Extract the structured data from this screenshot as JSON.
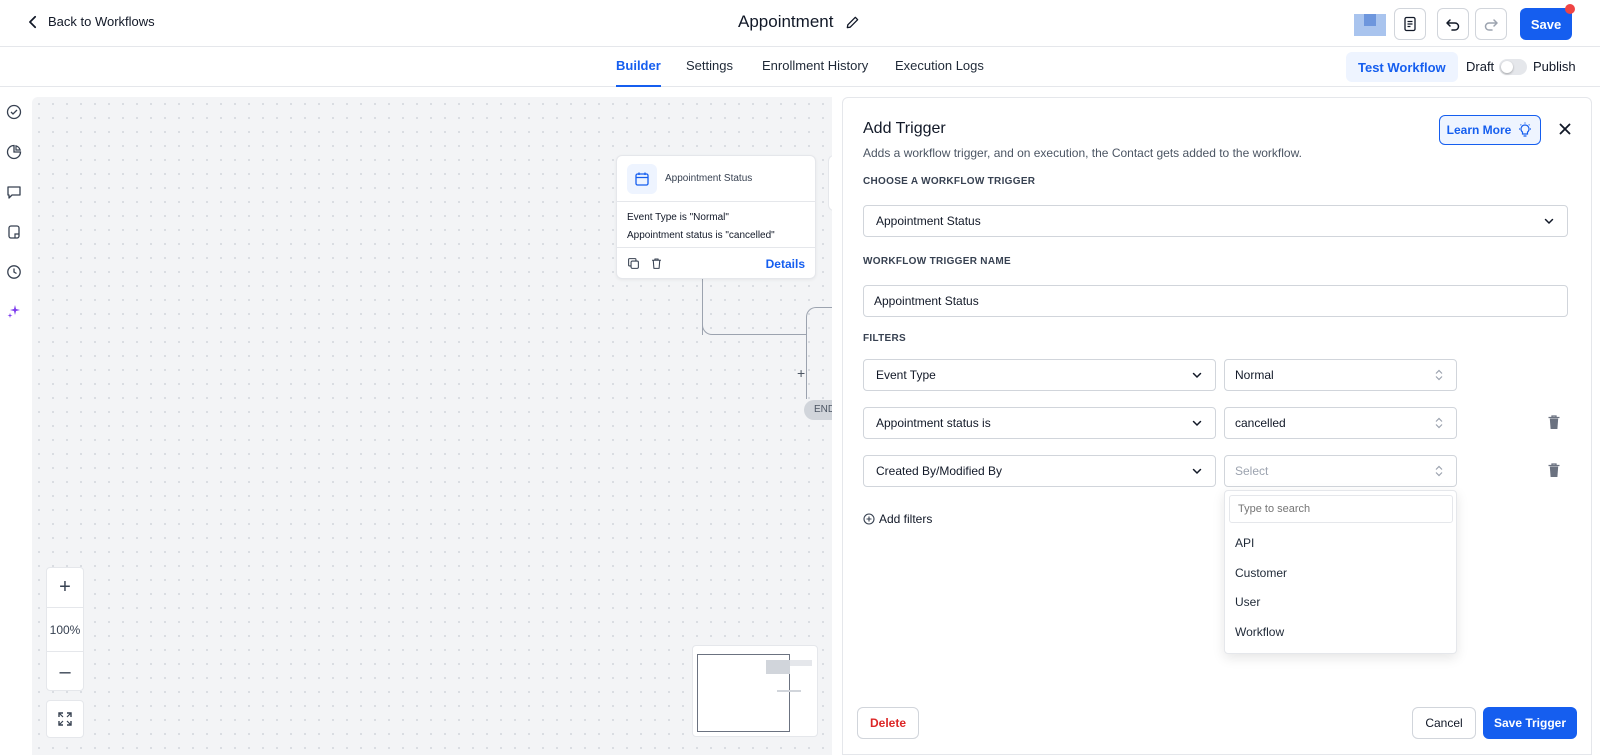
{
  "header": {
    "back_label": "Back to Workflows",
    "title": "Appointment",
    "save_label": "Save"
  },
  "tabs": [
    {
      "label": "Builder",
      "active": true
    },
    {
      "label": "Settings",
      "active": false
    },
    {
      "label": "Enrollment History",
      "active": false
    },
    {
      "label": "Execution Logs",
      "active": false
    }
  ],
  "tabbar": {
    "test_label": "Test Workflow",
    "draft_label": "Draft",
    "publish_label": "Publish",
    "published": false
  },
  "canvas": {
    "node": {
      "title": "Appointment Status",
      "conditions": [
        "Event Type is \"Normal\"",
        "Appointment status is \"cancelled\""
      ],
      "details_label": "Details"
    },
    "plus": "+",
    "end_label": "END",
    "zoom_in": "+",
    "zoom_level": "100%",
    "zoom_out": "–"
  },
  "panel": {
    "title": "Add Trigger",
    "subtitle": "Adds a workflow trigger, and on execution, the Contact gets added to the workflow.",
    "learn_more": "Learn More",
    "choose_label": "CHOOSE A WORKFLOW TRIGGER",
    "trigger_value": "Appointment Status",
    "name_label": "WORKFLOW TRIGGER NAME",
    "name_value": "Appointment Status",
    "filters_label": "FILTERS",
    "filters": [
      {
        "field": "Event Type",
        "value": "Normal"
      },
      {
        "field": "Appointment status is",
        "value": "cancelled"
      },
      {
        "field": "Created By/Modified By",
        "value": "Select"
      }
    ],
    "add_filters": "Add filters",
    "dropdown": {
      "search_placeholder": "Type to search",
      "options": [
        "API",
        "Customer",
        "User",
        "Workflow"
      ]
    },
    "delete_label": "Delete",
    "cancel_label": "Cancel",
    "save_trigger_label": "Save Trigger"
  },
  "colors": {
    "accent": "#155eef",
    "danger": "#dc2626"
  }
}
